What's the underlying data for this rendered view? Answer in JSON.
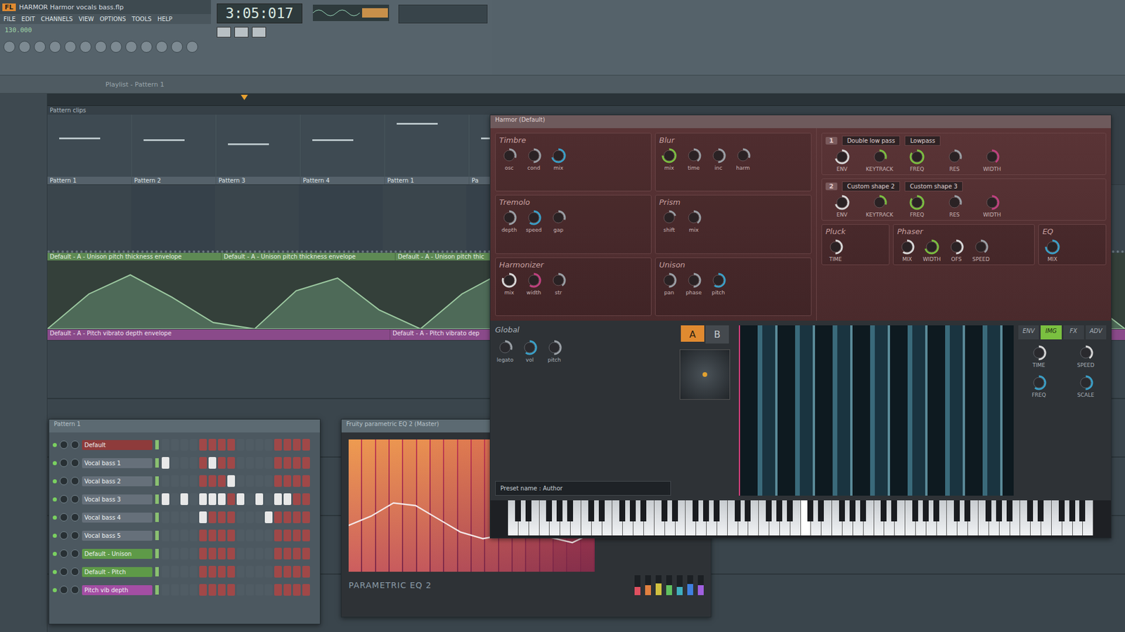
{
  "app": {
    "logo": "FL",
    "title": "HARMOR Harmor vocals bass.flp",
    "menu": [
      "FILE",
      "EDIT",
      "CHANNELS",
      "VIEW",
      "OPTIONS",
      "TOOLS",
      "HELP"
    ],
    "tempo": "130.000",
    "time": "3:05:017",
    "hint": "Playlist - Pattern 1"
  },
  "playlist": {
    "title": "Pattern clips",
    "clips": [
      {
        "label": "Pattern 1",
        "note": 0.55
      },
      {
        "label": "Pattern 2",
        "note": 0.6
      },
      {
        "label": "Pattern 3",
        "note": 0.7
      },
      {
        "label": "Pattern 4",
        "note": 0.6
      },
      {
        "label": "Pattern 1",
        "note": 0.2
      },
      {
        "label": "Pa",
        "note": 0.55
      }
    ],
    "automation": [
      {
        "label": "Default - A - Unison pitch thickness envelope"
      },
      {
        "label": "Default - A - Unison pitch thickness envelope"
      },
      {
        "label": "Default - A - Unison pitch thic"
      }
    ],
    "automation2": [
      {
        "label": "Default - A - Pitch vibrato depth envelope"
      },
      {
        "label": "Default - A - Pitch vibrato dep"
      }
    ],
    "envelope": [
      0.0,
      0.55,
      0.85,
      0.5,
      0.1,
      0.0,
      0.6,
      0.8,
      0.3,
      0.0,
      0.55,
      0.9,
      0.6,
      0.05,
      0.0,
      0.65,
      0.95,
      0.4,
      0.0,
      0.55,
      0.85,
      0.25,
      0.0,
      0.6,
      0.9,
      0.5,
      0.0
    ]
  },
  "channel_rack": {
    "title": "Pattern 1",
    "channels": [
      {
        "name": "Default",
        "color": "#8e3b3b",
        "steps": [
          false,
          false,
          false,
          false,
          false,
          false,
          false,
          false,
          false,
          false,
          false,
          false,
          false,
          false,
          false,
          false
        ]
      },
      {
        "name": "Vocal bass 1",
        "color": "#66707a",
        "steps": [
          true,
          false,
          false,
          false,
          false,
          true,
          false,
          false,
          false,
          false,
          false,
          false,
          false,
          false,
          false,
          false
        ]
      },
      {
        "name": "Vocal bass 2",
        "color": "#66707a",
        "steps": [
          false,
          false,
          false,
          false,
          false,
          false,
          false,
          true,
          false,
          false,
          false,
          false,
          false,
          false,
          false,
          false
        ]
      },
      {
        "name": "Vocal bass 3",
        "color": "#66707a",
        "steps": [
          true,
          false,
          true,
          false,
          true,
          true,
          true,
          false,
          true,
          false,
          true,
          false,
          true,
          true,
          false,
          false
        ]
      },
      {
        "name": "Vocal bass 4",
        "color": "#66707a",
        "steps": [
          false,
          false,
          false,
          false,
          true,
          false,
          false,
          false,
          false,
          false,
          false,
          true,
          false,
          false,
          false,
          false
        ]
      },
      {
        "name": "Vocal bass 5",
        "color": "#66707a",
        "steps": [
          false,
          false,
          false,
          false,
          false,
          false,
          false,
          false,
          false,
          false,
          false,
          false,
          false,
          false,
          false,
          false
        ]
      },
      {
        "name": "Default - Unison",
        "color": "#5e9a48",
        "steps": [
          false,
          false,
          false,
          false,
          false,
          false,
          false,
          false,
          false,
          false,
          false,
          false,
          false,
          false,
          false,
          false
        ]
      },
      {
        "name": "Default - Pitch",
        "color": "#5e9a48",
        "steps": [
          false,
          false,
          false,
          false,
          false,
          false,
          false,
          false,
          false,
          false,
          false,
          false,
          false,
          false,
          false,
          false
        ]
      },
      {
        "name": "Pitch vib depth",
        "color": "#a44ea4",
        "steps": [
          false,
          false,
          false,
          false,
          false,
          false,
          false,
          false,
          false,
          false,
          false,
          false,
          false,
          false,
          false,
          false
        ]
      }
    ]
  },
  "eq": {
    "title": "Fruity parametric EQ 2 (Master)",
    "label": "PARAMETRIC EQ 2",
    "spectrum": [
      0.95,
      0.9,
      0.85,
      0.9,
      0.8,
      0.85,
      0.75,
      0.7,
      0.65,
      0.6,
      0.55,
      0.5,
      0.45,
      0.35,
      0.3,
      0.2,
      0.15,
      0.1
    ],
    "curve": [
      0.35,
      0.42,
      0.52,
      0.5,
      0.4,
      0.3,
      0.25,
      0.28,
      0.3,
      0.26,
      0.22,
      0.3
    ],
    "bands": [
      {
        "level": 0.4,
        "color": "#e05060"
      },
      {
        "level": 0.5,
        "color": "#e08040"
      },
      {
        "level": 0.6,
        "color": "#d0c040"
      },
      {
        "level": 0.5,
        "color": "#60c060"
      },
      {
        "level": 0.4,
        "color": "#40b0c0"
      },
      {
        "level": 0.55,
        "color": "#4080e0"
      },
      {
        "level": 0.5,
        "color": "#a060e0"
      }
    ]
  },
  "harmor": {
    "title": "Harmor (Default)",
    "left_sections": [
      {
        "label": "Timbre",
        "knobs": [
          {
            "label": "osc",
            "level": 0.3,
            "color": "#9aa0a6"
          },
          {
            "label": "cond",
            "level": 0.5,
            "color": "#9aa0a6"
          },
          {
            "label": "mix",
            "level": 0.7,
            "color": "#3aa0c8"
          }
        ]
      },
      {
        "label": "Blur",
        "knobs": [
          {
            "label": "mix",
            "level": 0.75,
            "color": "#7ac040"
          },
          {
            "label": "time",
            "level": 0.4,
            "color": "#9aa0a6"
          },
          {
            "label": "inc",
            "level": 0.5,
            "color": "#9aa0a6"
          },
          {
            "label": "harm",
            "level": 0.3,
            "color": "#9aa0a6"
          }
        ]
      },
      {
        "label": "Tremolo",
        "knobs": [
          {
            "label": "depth",
            "level": 0.5,
            "color": "#9aa0a6"
          },
          {
            "label": "speed",
            "level": 0.6,
            "color": "#3aa0c8"
          },
          {
            "label": "gap",
            "level": 0.3,
            "color": "#9aa0a6"
          }
        ]
      },
      {
        "label": "Prism",
        "knobs": [
          {
            "label": "shift",
            "level": 0.2,
            "color": "#9aa0a6"
          },
          {
            "label": "mix",
            "level": 0.4,
            "color": "#9aa0a6"
          }
        ]
      },
      {
        "label": "Harmonizer",
        "knobs": [
          {
            "label": "mix",
            "level": 0.8,
            "color": "#d8d8d8"
          },
          {
            "label": "width",
            "level": 0.6,
            "color": "#c04080"
          },
          {
            "label": "str",
            "level": 0.4,
            "color": "#9aa0a6"
          }
        ]
      },
      {
        "label": "Unison",
        "knobs": [
          {
            "label": "pan",
            "level": 0.5,
            "color": "#9aa0a6"
          },
          {
            "label": "phase",
            "level": 0.5,
            "color": "#9aa0a6"
          },
          {
            "label": "pitch",
            "level": 0.6,
            "color": "#3aa0c8"
          }
        ]
      }
    ],
    "filters": [
      {
        "number": "1",
        "type": "Double low pass",
        "mode": "Lowpass",
        "knobs": [
          {
            "label": "ENV",
            "level": 0.7,
            "color": "#d8d8d8"
          },
          {
            "label": "KEYTRACK",
            "level": 0.3,
            "color": "#7ac040"
          },
          {
            "label": "FREQ",
            "level": 0.85,
            "color": "#7ac040"
          },
          {
            "label": "RES",
            "level": 0.3,
            "color": "#9aa0a6"
          },
          {
            "label": "WIDTH",
            "level": 0.4,
            "color": "#c04080"
          }
        ]
      },
      {
        "number": "2",
        "type": "Custom shape 2",
        "mode": "Custom shape 3",
        "knobs": [
          {
            "label": "ENV",
            "level": 0.7,
            "color": "#d8d8d8"
          },
          {
            "label": "KEYTRACK",
            "level": 0.3,
            "color": "#7ac040"
          },
          {
            "label": "FREQ",
            "level": 0.85,
            "color": "#7ac040"
          },
          {
            "label": "RES",
            "level": 0.3,
            "color": "#9aa0a6"
          },
          {
            "label": "WIDTH",
            "level": 0.5,
            "color": "#c04080"
          }
        ]
      }
    ],
    "bottom_sections": [
      {
        "label": "Pluck",
        "knobs": [
          {
            "label": "TIME",
            "level": 0.5,
            "color": "#d8d8d8"
          }
        ]
      },
      {
        "label": "Phaser",
        "knobs": [
          {
            "label": "MIX",
            "level": 0.6,
            "color": "#d8d8d8"
          },
          {
            "label": "WIDTH",
            "level": 0.7,
            "color": "#7ac040"
          },
          {
            "label": "OFS",
            "level": 0.5,
            "color": "#d8d8d8"
          },
          {
            "label": "SPEED",
            "level": 0.4,
            "color": "#9aa0a6"
          }
        ]
      },
      {
        "label": "EQ",
        "knobs": [
          {
            "label": "MIX",
            "level": 0.75,
            "color": "#3aa0c8"
          }
        ]
      }
    ],
    "global": {
      "label": "Global",
      "knobs": [
        {
          "label": "legato",
          "level": 0.3,
          "color": "#9aa0a6"
        },
        {
          "label": "vol",
          "level": 0.6,
          "color": "#3aa0c8"
        },
        {
          "label": "pitch",
          "level": 0.5,
          "color": "#9aa0a6"
        }
      ]
    },
    "ab": [
      {
        "label": "A",
        "selected": true
      },
      {
        "label": "B",
        "selected": false
      }
    ],
    "preset": "Preset name : Author",
    "side_tabs": [
      {
        "label": "ENV",
        "selected": false
      },
      {
        "label": "IMG",
        "selected": true
      },
      {
        "label": "FX",
        "selected": false
      },
      {
        "label": "ADV",
        "selected": false
      }
    ],
    "side_knobs": [
      {
        "label": "TIME",
        "level": 0.5,
        "color": "#d8d8d8"
      },
      {
        "label": "SPEED",
        "level": 0.4,
        "color": "#d8d8d8"
      },
      {
        "label": "FREQ",
        "level": 0.6,
        "color": "#3aa0c8"
      },
      {
        "label": "SCALE",
        "level": 0.5,
        "color": "#3aa0c8"
      }
    ],
    "keyboard": {
      "white_keys": 56,
      "pressed": 28
    }
  }
}
